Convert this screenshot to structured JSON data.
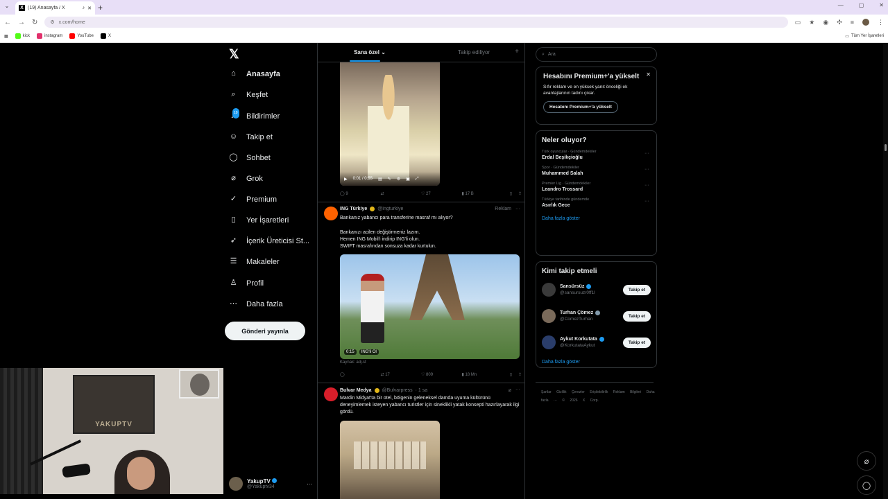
{
  "browser": {
    "tab_title": "(19) Anasayfa / X",
    "url": "x.com/home",
    "bookmarks": [
      {
        "label": "kick",
        "color": "#53fc18"
      },
      {
        "label": "instagram",
        "color": "#e1306c"
      },
      {
        "label": "YouTube",
        "color": "#ff0000"
      },
      {
        "label": "X",
        "color": "#000000"
      }
    ],
    "all_bookmarks": "Tüm Yer İşaretleri"
  },
  "nav": {
    "items": [
      {
        "label": "Anasayfa",
        "icon": "home-icon",
        "glyph": "⌂"
      },
      {
        "label": "Keşfet",
        "icon": "search-icon",
        "glyph": "⌕"
      },
      {
        "label": "Bildirimler",
        "icon": "bell-icon",
        "glyph": "♫"
      },
      {
        "label": "Takip et",
        "icon": "follow-icon",
        "glyph": "☺"
      },
      {
        "label": "Sohbet",
        "icon": "chat-icon",
        "glyph": "◯"
      },
      {
        "label": "Grok",
        "icon": "grok-icon",
        "glyph": "⌀"
      },
      {
        "label": "Premium",
        "icon": "premium-icon",
        "glyph": "✓"
      },
      {
        "label": "Yer İşaretleri",
        "icon": "bookmark-icon",
        "glyph": "▯"
      },
      {
        "label": "İçerik Üreticisi St...",
        "icon": "rocket-icon",
        "glyph": "➶"
      },
      {
        "label": "Makaleler",
        "icon": "articles-icon",
        "glyph": "☰"
      },
      {
        "label": "Profil",
        "icon": "profile-icon",
        "glyph": "♙"
      },
      {
        "label": "Daha fazla",
        "icon": "more-icon",
        "glyph": "⋯"
      }
    ],
    "notif_badge": "19",
    "post_button": "Gönderi yayınla",
    "profile_name": "YakupTV",
    "profile_handle": "@Yakuptv34"
  },
  "webcam": {
    "poster_text": "YAKUPTV"
  },
  "timeline": {
    "tab_for_you": "Sana özel",
    "tab_following": "Takip ediliyor",
    "tweet1": {
      "time": "0:01 / 0:55",
      "replies": "9",
      "retweets": "",
      "likes": "27",
      "views": "17 B"
    },
    "tweet2": {
      "name": "ING Türkiye",
      "handle": "@ingturkiye",
      "ad": "Reklam",
      "text": "Bankanız yabancı para transferine masraf mı alıyor?",
      "body1": "Bankanızı acilen değiştirmeniz lazım.",
      "body2": "Hemen ING Mobil'i indirip ING'li olun.",
      "body3": "SWIFT masrafından sonsuza kadar kurtulun.",
      "video_time": "0:15",
      "video_tag": "ING'li Ol",
      "source": "Kaynak: adj.st",
      "replies": "",
      "retweets": "17",
      "likes": "809",
      "views": "18 Mn"
    },
    "tweet3": {
      "name": "Bulvar Medya",
      "handle": "@Bulvarpress",
      "time": "· 1 sa",
      "text": "Mardin Midyat'ta bir otel, bölgenin geleneksel damda uyuma kültürünü deneyimlemek isteyen yabancı turistler için sineklikli yatak konsepti hazırlayarak ilgi gördü."
    }
  },
  "sidebar": {
    "search_placeholder": "Ara",
    "premium": {
      "title": "Hesabını Premium+'a yükselt",
      "text": "Sıfır reklam ve en yüksek yanıt önceliği ek avantajlarının tadını çıkar.",
      "button": "Hesabını Premium+'a yükselt"
    },
    "trends_title": "Neler oluyor?",
    "trends": [
      {
        "meta": "Türk oyuncular · Gündemdekiler",
        "name": "Erdal Beşikçioğlu"
      },
      {
        "meta": "Spor · Gündemdekiler",
        "name": "Muhammed Salah"
      },
      {
        "meta": "Premier Lig · Gündemdekiler",
        "name": "Leandro Trossard"
      },
      {
        "meta": "Türkiye tarihinde gündemde",
        "name": "Asırlık Gece"
      }
    ],
    "show_more": "Daha fazla göster",
    "who_title": "Kimi takip etmeli",
    "who": [
      {
        "name": "Sansürsüz",
        "handle": "@sansursuzr0ff1l",
        "color": "#3a3a3a",
        "badge": "blue"
      },
      {
        "name": "Turhan Çömez",
        "handle": "@ComezTurhan",
        "color": "#7a6a5a",
        "badge": "gray"
      },
      {
        "name": "Aykut Korkutata",
        "handle": "@KorkutataAykut",
        "color": "#2a3d6a",
        "badge": "blue"
      }
    ],
    "follow_label": "Takip et",
    "footer": "Şartlar Gizlilik Çerezler Erişilebilirlik Reklam Bilgileri Daha fazla ··· © 2026 X Corp."
  }
}
